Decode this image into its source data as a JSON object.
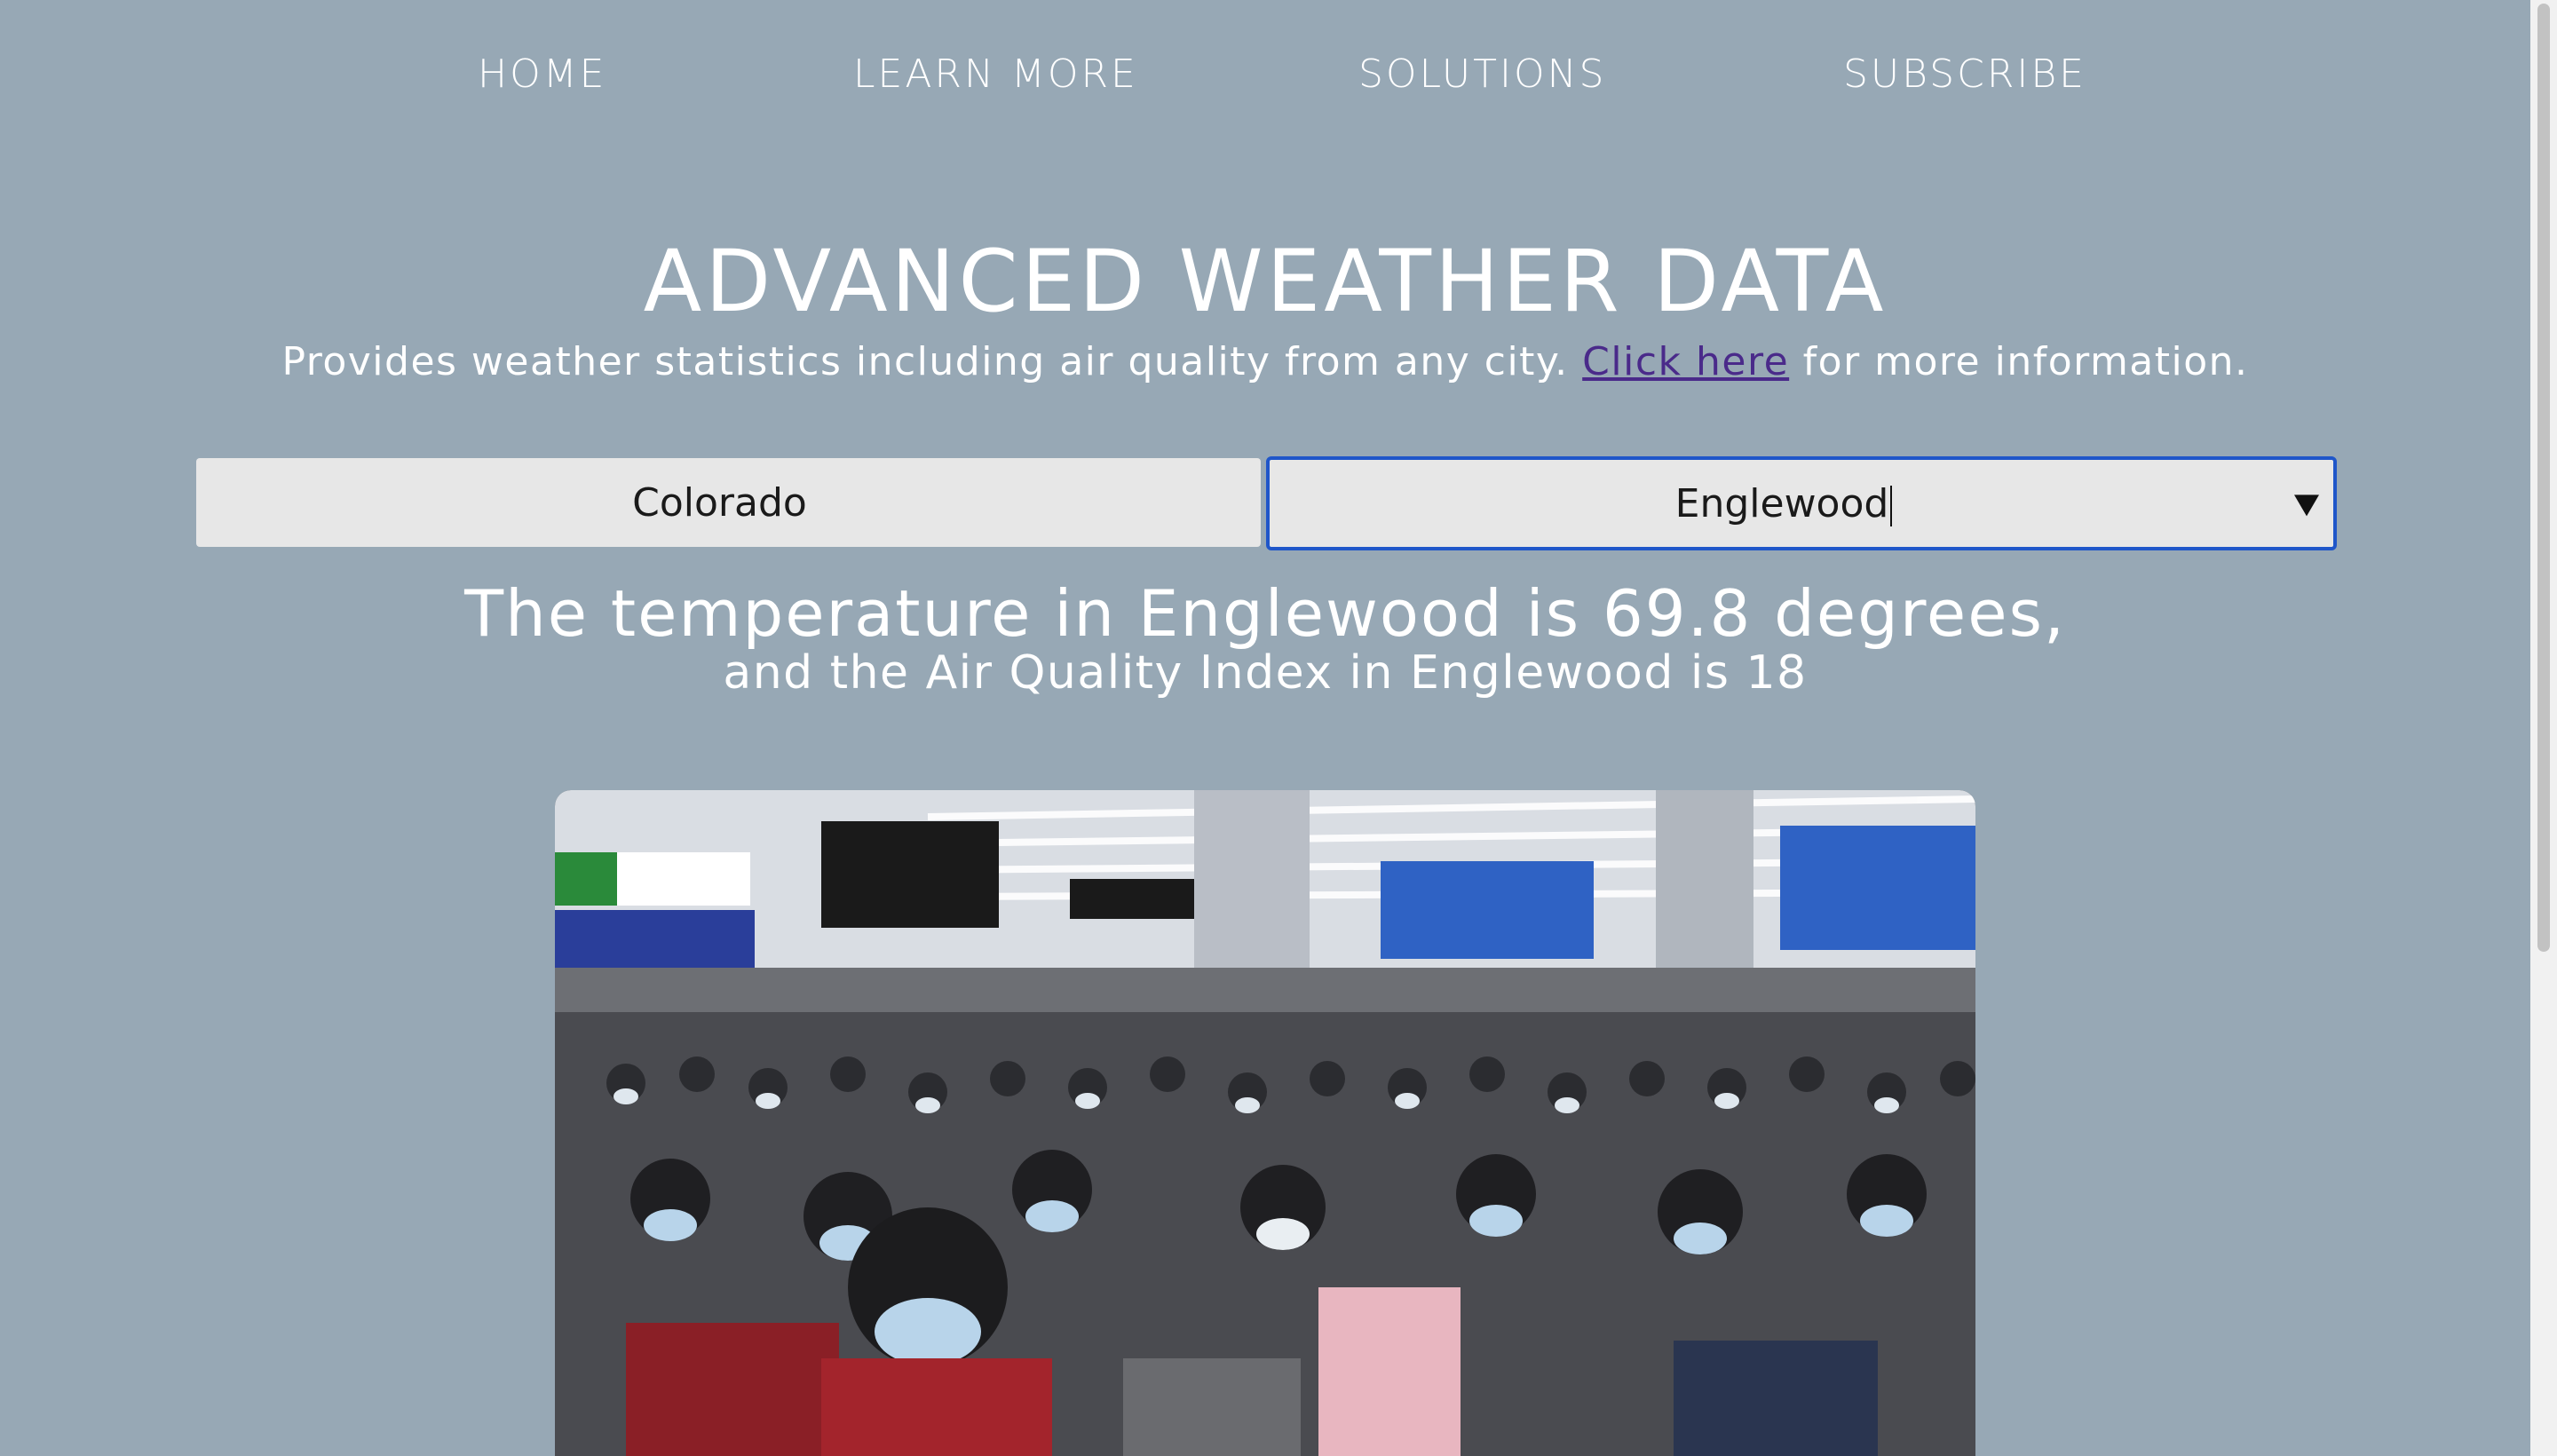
{
  "nav": {
    "items": [
      {
        "label": "HOME"
      },
      {
        "label": "LEARN MORE"
      },
      {
        "label": "SOLUTIONS"
      },
      {
        "label": "SUBSCRIBE"
      }
    ]
  },
  "header": {
    "title": "ADVANCED WEATHER DATA",
    "subtitle_before": "Provides weather statistics including air quality from any city.",
    "subtitle_link": "Click here",
    "subtitle_after": "for more information."
  },
  "selectors": {
    "state_value": "Colorado",
    "city_value": "Englewood"
  },
  "result": {
    "line1": "The temperature in Englewood is 69.8 degrees,",
    "line2": "and the Air Quality Index in Englewood is 18"
  },
  "colors": {
    "background": "#97a8b5",
    "link": "#4a2a8a",
    "focus_border": "#1f56c9",
    "input_bg": "#e7e7e7"
  },
  "icons": {
    "dropdown": "triangle-down-icon"
  }
}
